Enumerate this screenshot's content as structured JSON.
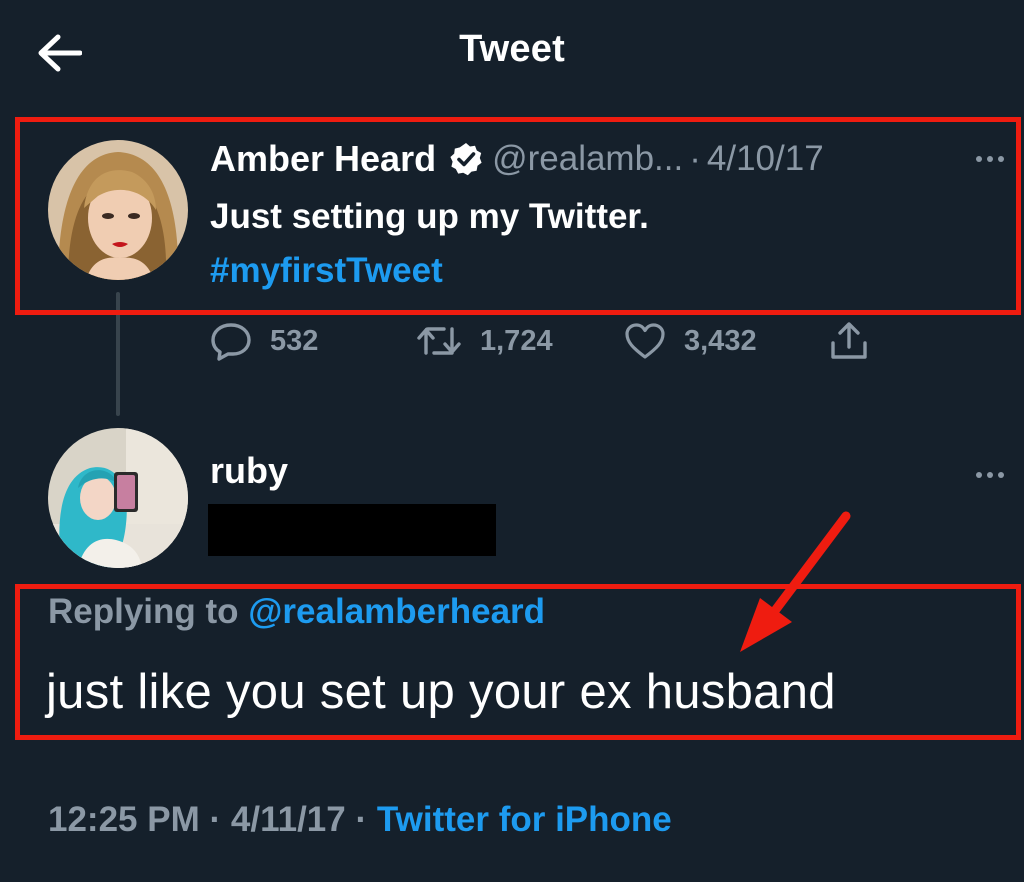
{
  "header": {
    "title": "Tweet",
    "back_icon": "arrow-left-icon"
  },
  "original_tweet": {
    "display_name": "Amber Heard",
    "handle": "@realamb...",
    "separator": "·",
    "date": "4/10/17",
    "text_line1": "Just setting up my Twitter.",
    "hashtag": "#myfirstTweet",
    "stats": {
      "replies": "532",
      "retweets": "1,724",
      "likes": "3,432"
    }
  },
  "reply_tweet": {
    "display_name": "ruby",
    "replying_prefix": "Replying to",
    "replying_handle": "@realamberheard",
    "text": "just like you set up your ex husband",
    "time": "12:25 PM",
    "separator1": "·",
    "date": "4/11/17",
    "separator2": "·",
    "source": "Twitter for iPhone"
  },
  "colors": {
    "background": "#15202b",
    "link": "#1d9bf0",
    "muted": "#8b98a5",
    "annotation": "#ef1c10"
  }
}
